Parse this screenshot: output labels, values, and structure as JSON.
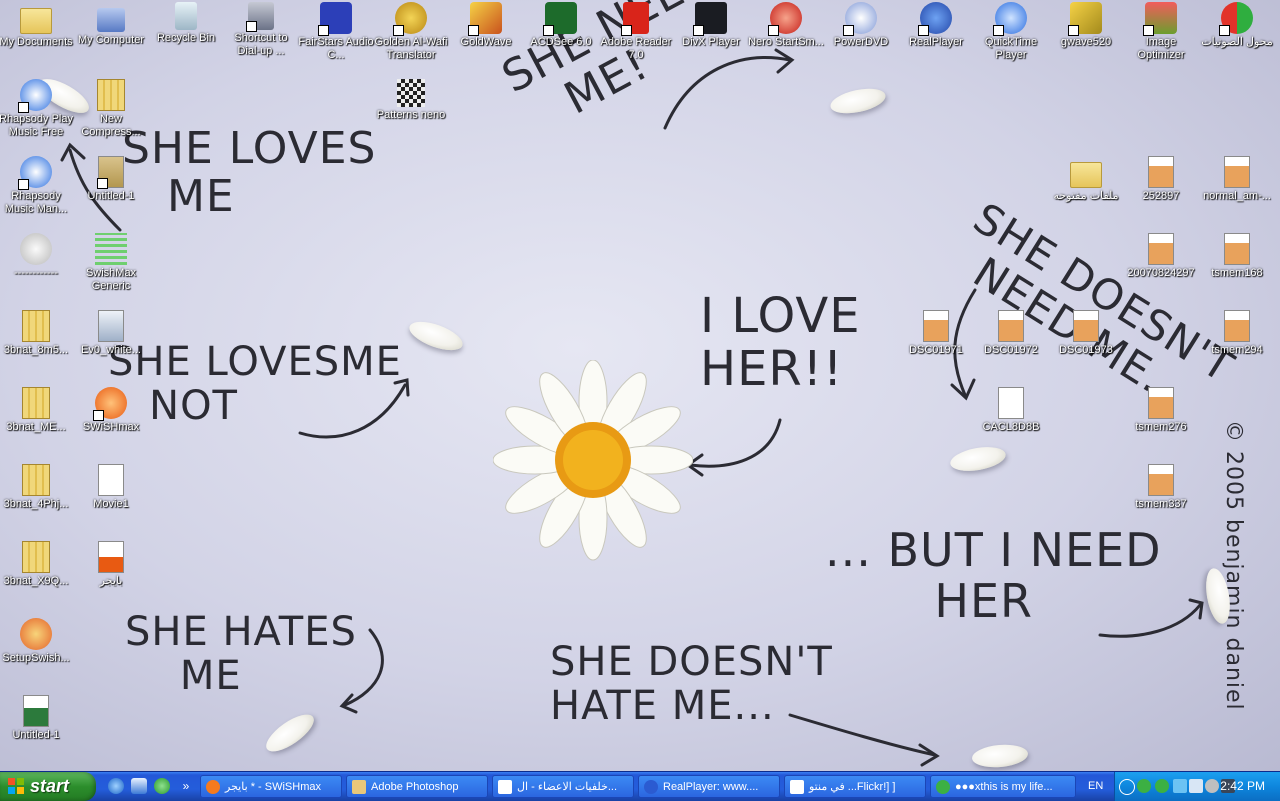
{
  "wallpaper": {
    "phrases": [
      "SHE LOVES\n   ME",
      "SHE NEEDS\n   ME!",
      "SHE DOESN'T\n  NEED ME..",
      "SHE LOVESME\n   NOT",
      "I LOVE\nHER!!",
      "... BUT I NEED\n       HER",
      "SHE HATES\n    ME",
      "SHE DOESN'T\nHATE ME...",
      "© 2005 benjamin daniel"
    ]
  },
  "desktop_icons": [
    {
      "label": "My Documents",
      "icon": "my-documents-icon"
    },
    {
      "label": "My Computer",
      "icon": "my-computer-icon"
    },
    {
      "label": "Recycle Bin",
      "icon": "recycle-bin-icon"
    },
    {
      "label": "Shortcut to Dial-up ...",
      "icon": "dialup-icon"
    },
    {
      "label": "FairStars Audio C...",
      "icon": "fairstars-icon"
    },
    {
      "label": "Golden Al-Wafi Translator",
      "icon": "translator-icon"
    },
    {
      "label": "GoldWave",
      "icon": "goldwave-icon"
    },
    {
      "label": "ACDSee 6.0",
      "icon": "acdsee-icon"
    },
    {
      "label": "Adobe Reader 7.0",
      "icon": "adobe-reader-icon"
    },
    {
      "label": "DivX Player",
      "icon": "divx-icon"
    },
    {
      "label": "Nero StartSm...",
      "icon": "nero-icon"
    },
    {
      "label": "PowerDVD",
      "icon": "powerdvd-icon"
    },
    {
      "label": "RealPlayer",
      "icon": "realplayer-icon"
    },
    {
      "label": "QuickTime Player",
      "icon": "quicktime-icon"
    },
    {
      "label": "gwave520",
      "icon": "gwave-icon"
    },
    {
      "label": "Image Optimizer",
      "icon": "image-optimizer-icon"
    },
    {
      "label": "محول الصوتيات",
      "icon": "audio-converter-icon"
    },
    {
      "label": "Rhapsody Play Music Free",
      "icon": "rhapsody-icon"
    },
    {
      "label": "New Compress...",
      "icon": "zip-folder-icon"
    },
    {
      "label": "Patterns neno",
      "icon": "pattern-icon"
    },
    {
      "label": "Rhapsody Music Man...",
      "icon": "rhapsody-icon"
    },
    {
      "label": "Untitled-1",
      "icon": "psd-file-icon"
    },
    {
      "label": "------------",
      "icon": "disc-icon"
    },
    {
      "label": "SwishMax Generic",
      "icon": "swishmax-icon"
    },
    {
      "label": "3bnat_8m5...",
      "icon": "zip-folder-icon"
    },
    {
      "label": "Ev0_white...",
      "icon": "image-file-icon"
    },
    {
      "label": "3bnat_ME...",
      "icon": "zip-folder-icon"
    },
    {
      "label": "SWiSHmax",
      "icon": "swishmax-icon"
    },
    {
      "label": "3bnat_4Phj...",
      "icon": "zip-folder-icon"
    },
    {
      "label": "Movie1",
      "icon": "flash-file-icon"
    },
    {
      "label": "3bnat_X9Q...",
      "icon": "zip-folder-icon"
    },
    {
      "label": "بايجر",
      "icon": "swish-file-icon"
    },
    {
      "label": "SetupSwish...",
      "icon": "setup-icon"
    },
    {
      "label": "Untitled-1",
      "icon": "gif-file-icon"
    },
    {
      "label": "ملفات مفتوحه",
      "icon": "folder-icon"
    },
    {
      "label": "252897",
      "icon": "image-file-icon"
    },
    {
      "label": "normal_am-...",
      "icon": "image-file-icon"
    },
    {
      "label": "20070824297",
      "icon": "image-file-icon"
    },
    {
      "label": "tsmem168",
      "icon": "image-file-icon"
    },
    {
      "label": "DSC01971",
      "icon": "image-file-icon"
    },
    {
      "label": "DSC01972",
      "icon": "image-file-icon"
    },
    {
      "label": "DSC01973",
      "icon": "image-file-icon"
    },
    {
      "label": "tsmem294",
      "icon": "image-file-icon"
    },
    {
      "label": "CACL8D8B",
      "icon": "flash-file-icon"
    },
    {
      "label": "tsmem276",
      "icon": "image-file-icon"
    },
    {
      "label": "tsmem337",
      "icon": "image-file-icon"
    }
  ],
  "taskbar": {
    "start_label": "start",
    "quick_launch": [
      "ie-icon",
      "outlook-icon",
      "messenger-icon"
    ],
    "overflow": "»",
    "tasks": [
      {
        "label": "بايجر * - SWiSHmax",
        "icon": "swishmax-icon",
        "color": "#f57a1e"
      },
      {
        "label": "Adobe Photoshop",
        "icon": "photoshop-icon",
        "color": "#e9c77a"
      },
      {
        "label": "خلفيات الاعضاء - ال...",
        "icon": "ie-icon",
        "color": "#ffffff"
      },
      {
        "label": "RealPlayer: www....",
        "icon": "realplayer-icon",
        "color": "#2b5bd1"
      },
      {
        "label": "في منتو ...Flickr!] ]",
        "icon": "ie-icon",
        "color": "#ffffff"
      },
      {
        "label": "●●●xthis is my life...",
        "icon": "messenger-icon",
        "color": "#3cb043"
      }
    ],
    "language": "EN",
    "tray_icons": [
      "collapse-icon",
      "messenger-icon",
      "messenger-icon",
      "network-icon",
      "volume-icon",
      "security-icon",
      "monitor-icon"
    ],
    "clock": "2:42 PM"
  }
}
